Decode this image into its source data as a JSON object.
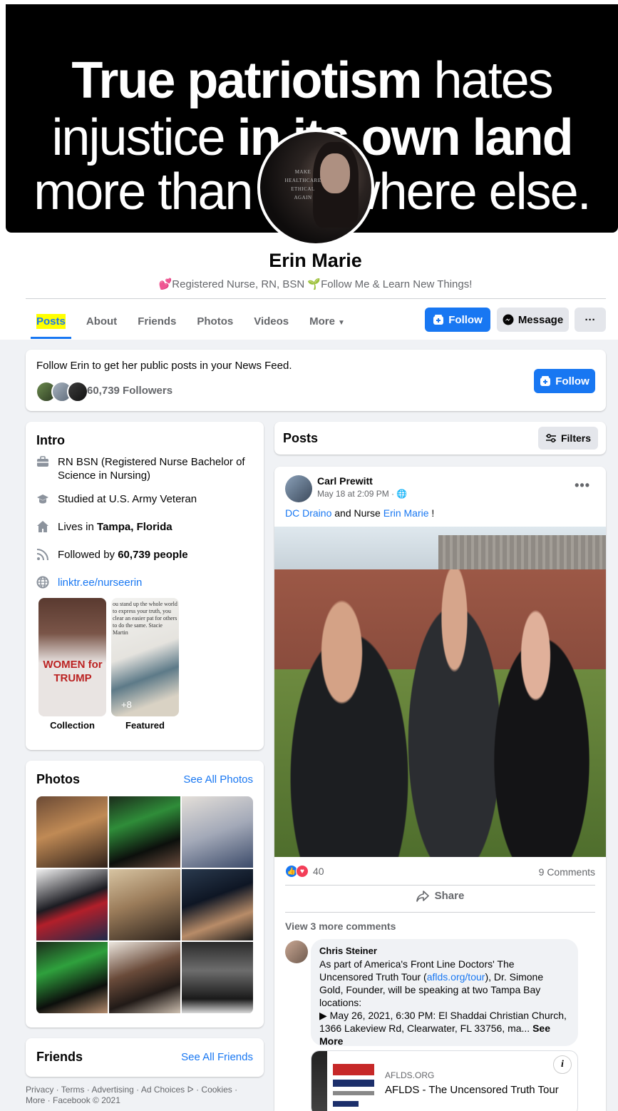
{
  "cover": {
    "line1_bold": "True patriotism",
    "line1_rest": " hates",
    "line2_pre": "injustice ",
    "line2_bold": "in its own land",
    "line3": "more than anywhere else."
  },
  "profile_picture": {
    "text_lines": [
      "MAKE",
      "HEALTHCARE",
      "ETHICAL",
      "AGAIN"
    ]
  },
  "profile": {
    "name": "Erin Marie",
    "bio_part1": "Registered Nurse, RN, BSN",
    "bio_part2": "Follow Me & Learn New Things!",
    "heart_emoji": "💕",
    "sprout_emoji": "🌱"
  },
  "tabs": [
    "Posts",
    "About",
    "Friends",
    "Photos",
    "Videos",
    "More"
  ],
  "actions": {
    "follow": "Follow",
    "message": "Message",
    "more": "···"
  },
  "follow_card": {
    "text": "Follow Erin to get her public posts in your News Feed.",
    "followers": "60,739 Followers",
    "button": "Follow"
  },
  "intro": {
    "title": "Intro",
    "work": "RN BSN (Registered Nurse Bachelor of Science in Nursing)",
    "education": "Studied at U.S. Army Veteran",
    "lives_prefix": "Lives in ",
    "lives_city": "Tampa, Florida",
    "followed_prefix": "Followed by ",
    "followed_count": "60,739 people",
    "link": "linktr.ee/nurseerin",
    "highlights": [
      {
        "label": "Collection"
      },
      {
        "label": "Featured",
        "badge": "+8"
      }
    ],
    "collection_thumb_text": "WOMEN for TRUMP",
    "featured_thumb_text": "ou stand up the whole world to express your truth, you clear an easier pat for others to do the same. Stacie Martin"
  },
  "photos": {
    "title": "Photos",
    "see_all": "See All Photos"
  },
  "friends": {
    "title": "Friends",
    "see_all": "See All Friends"
  },
  "footer": {
    "line1": "Privacy · Terms · Advertising · Ad Choices ᐅ · Cookies ·",
    "line2": "More · Facebook © 2021"
  },
  "posts_header": {
    "title": "Posts",
    "filters": "Filters"
  },
  "post": {
    "author": "Carl Prewitt",
    "time": "May 18 at 2:09 PM ·",
    "text_link1": "DC Draino",
    "text_mid": " and Nurse ",
    "text_link2": "Erin Marie",
    "text_end": " !",
    "reactions_count": "40",
    "comments_count": "9 Comments",
    "share": "Share",
    "view_more": "View 3 more comments",
    "comment": {
      "author": "Chris Steiner",
      "text1": "As part of America's Front Line Doctors' The Uncensored Truth Tour (",
      "link": "aflds.org/tour",
      "text2": "), Dr. Simone Gold, Founder, will be speaking at two Tampa Bay locations:",
      "text3": "▶ May 26, 2021, 6:30 PM: El Shaddai Christian Church, 1366 Lakeview Rd, Clearwater, FL 33756, ma... ",
      "see_more": "See More"
    },
    "link_preview": {
      "domain": "AFLDS.ORG",
      "title": "AFLDS - The Uncensored Truth Tour",
      "info": "i"
    }
  },
  "colors": {
    "accent": "#1877f2",
    "highlight": "#ffff00",
    "like": "#1877f2",
    "love": "#f33e58"
  }
}
